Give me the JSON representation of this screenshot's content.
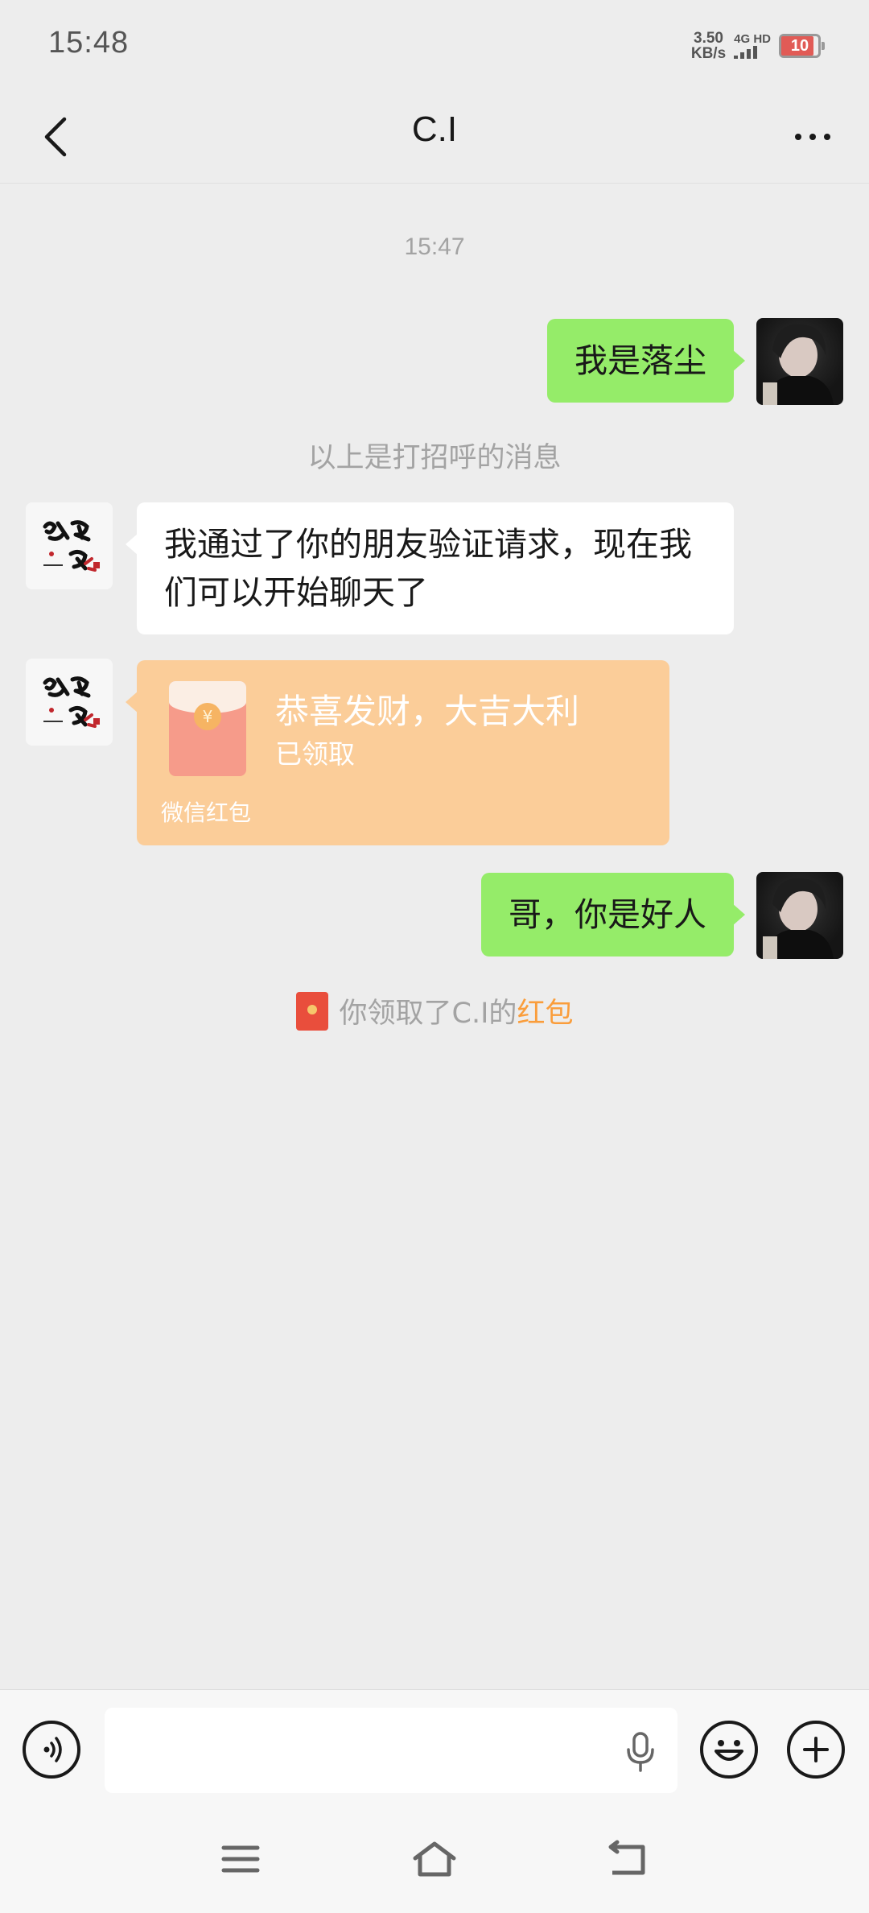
{
  "status_bar": {
    "time": "15:48",
    "net_speed_value": "3.50",
    "net_speed_unit": "KB/s",
    "network": "4G HD",
    "battery": "10",
    "battery_level": 0.1,
    "battery_color": "#e15b56"
  },
  "header": {
    "title": "C.I",
    "back_icon": "chevron-left-icon",
    "more_icon": "more-dots-icon"
  },
  "messages": {
    "timestamp": "15:47",
    "greeting_message": "我是落尘",
    "greeting_tip": "以上是打招呼的消息",
    "friend_message": "我通过了你的朋友验证请求，现在我们可以开始聊天了",
    "red_packet": {
      "title": "恭喜发财，大吉大利",
      "status": "已领取",
      "footer": "微信红包",
      "coin_symbol": "¥",
      "color": "#fbcd99"
    },
    "reply_message": "哥，你是好人",
    "received_note_prefix": "你领取了C.I的",
    "received_note_link": "红包"
  },
  "input_bar": {
    "voice_icon": "voice-icon",
    "mic_icon": "mic-icon",
    "emoji_icon": "emoji-icon",
    "plus_icon": "plus-icon"
  },
  "colors": {
    "sent_bubble": "#95ec69",
    "received_bubble": "#ffffff",
    "background": "#ededed",
    "link": "#fa9d3b"
  }
}
